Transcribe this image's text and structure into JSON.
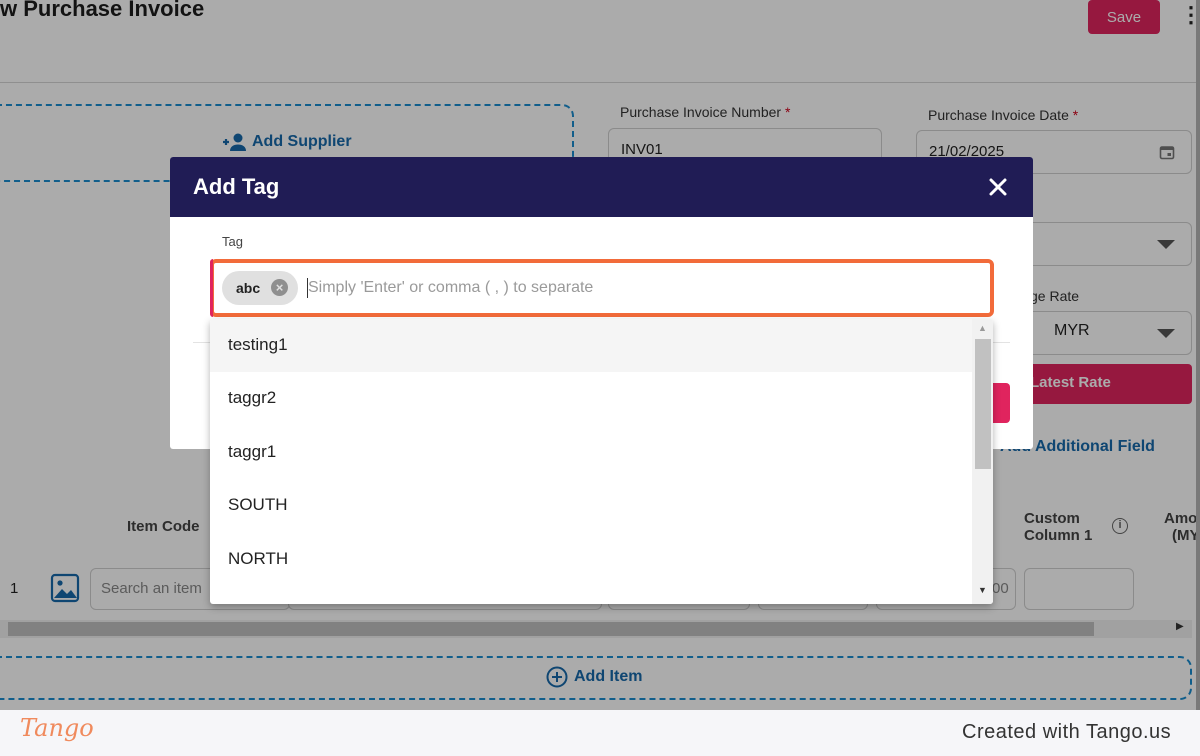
{
  "page": {
    "title": "w Purchase Invoice",
    "save_label": "Save",
    "add_supplier_label": "Add Supplier",
    "invoice_number_label": "Purchase Invoice Number",
    "invoice_number_value": "INV01",
    "invoice_date_label": "Purchase Invoice Date",
    "invoice_date_value": "21/02/2025",
    "required_mark": "*",
    "exchange_rate_label": "ge Rate",
    "currency_value": "MYR",
    "latest_rate_label": "Latest Rate",
    "add_field_label": "Add Additional Field",
    "col_item_code": "Item Code",
    "col_custom1_line1": "Custom",
    "col_custom1_line2": "Column 1",
    "col_amount_line1": "Amo",
    "col_amount_line2": "(MY",
    "row_number": "1",
    "item_search_placeholder": "Search an item",
    "row_zero_fragment": "00",
    "add_item_label": "Add Item"
  },
  "modal": {
    "title": "Add Tag",
    "tag_label": "Tag",
    "chips": [
      "abc"
    ],
    "placeholder": "Simply 'Enter' or comma ( , ) to separate",
    "options": [
      "testing1",
      "taggr2",
      "taggr1",
      "SOUTH",
      "NORTH"
    ]
  },
  "footer": {
    "logo": "Tango",
    "credit": "Created with Tango.us"
  },
  "colors": {
    "header": "#201c55",
    "accent": "#e0245e",
    "highlight": "#f26b3a",
    "link": "#1769aa"
  }
}
